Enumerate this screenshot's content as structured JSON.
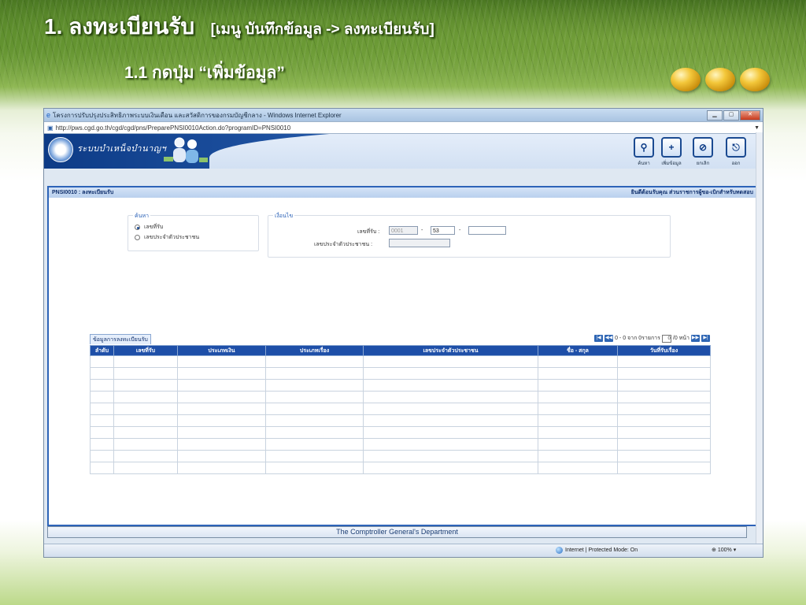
{
  "slide": {
    "title_main": "1. ลงทะเบียนรับ",
    "title_menu": "[เมนู บันทึกข้อมูล -> ลงทะเบียนรับ]",
    "subtitle": "1.1 กดปุ่ม “เพิ่มข้อมูล”"
  },
  "browser": {
    "window_title": "โครงการปรับปรุงประสิทธิภาพระบบเงินเดือน และสวัสดิการของกรมบัญชีกลาง - Windows Internet Explorer",
    "url": "http://pws.cgd.go.th/cgd/cgd/pns/PreparePNSI0010Action.do?programID=PNSI0010",
    "status_zone": "Internet | Protected Mode: On",
    "zoom": "100%"
  },
  "app": {
    "system_name": "ระบบบำเหน็จบำนาญฯ",
    "toolbar": {
      "search": "ค้นหา",
      "add": "เพิ่มข้อมูล",
      "cancel": "ยกเลิก",
      "exit": "ออก"
    },
    "screen_title": "PNSI0010 : ลงทะเบียนรับ",
    "welcome": "ยินดีต้อนรับคุณ ส่วนราชการผู้ขอ-เบิกสำหรับทดสอบ",
    "search_box": {
      "legend": "ค้นหา",
      "options": [
        {
          "label": "เลขที่รับ",
          "selected": true
        },
        {
          "label": "เลขประจำตัวประชาชน",
          "selected": false
        }
      ]
    },
    "condition_box": {
      "legend": "เงื่อนไข",
      "receive_no_label": "เลขที่รับ :",
      "receive_no_part1": "0001",
      "receive_no_sep": "-",
      "receive_no_part2": "53",
      "receive_no_part3": "",
      "citizen_id_label": "เลขประจำตัวประชาชน :",
      "citizen_id": ""
    },
    "grid": {
      "tab_label": "ข้อมูลการลงทะเบียนรับ",
      "pager": {
        "range_text": "0 - 0 จาก 0รายการ",
        "page": "0",
        "page_suffix": "/0 หน้า"
      },
      "columns": [
        "ลำดับ",
        "เลขที่รับ",
        "ประเภทเงิน",
        "ประเภทเรื่อง",
        "เลขประจำตัวประชาชน",
        "ชื่อ - สกุล",
        "วันที่รับเรื่อง"
      ]
    },
    "footer": "The Comptroller General's Department"
  }
}
